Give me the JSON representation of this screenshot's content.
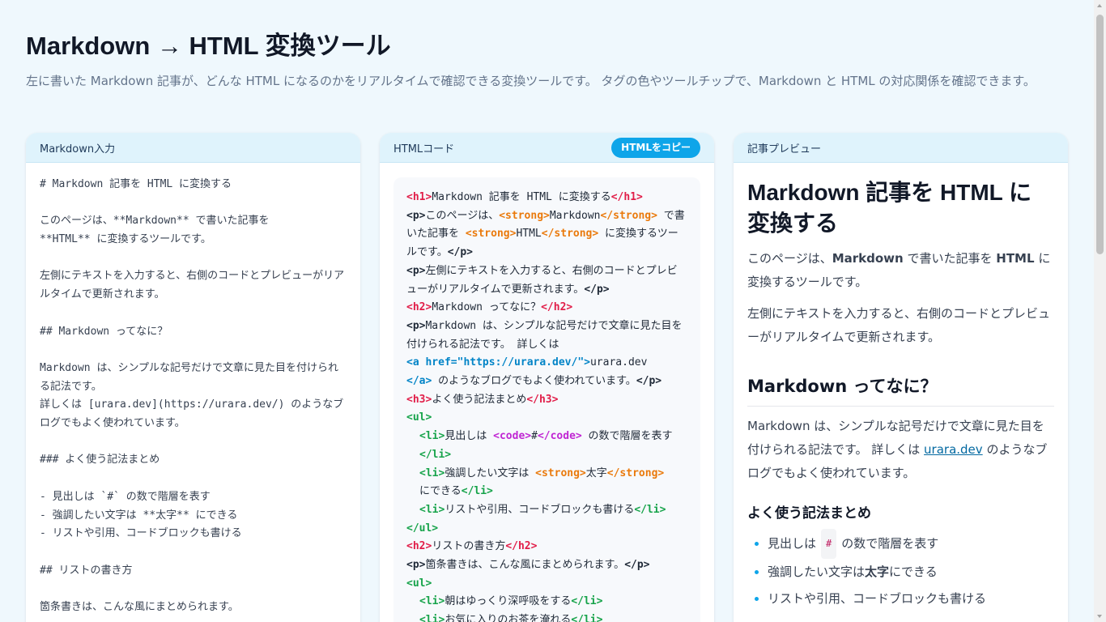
{
  "header": {
    "title": "Markdown → HTML 変換ツール",
    "description": "左に書いた Markdown 記事が、どんな HTML になるのかをリアルタイムで確認できる変換ツールです。 タグの色やツールチップで、Markdown と HTML の対応関係を確認できます。"
  },
  "panels": {
    "markdown_label": "Markdown入力",
    "html_label": "HTMLコード",
    "copy_button": "HTMLをコピー",
    "preview_label": "記事プレビュー"
  },
  "markdown_lines": [
    "# Markdown 記事を HTML に変換する",
    "",
    "このページは、**Markdown** で書いた記事を",
    "**HTML** に変換するツールです。",
    "",
    "左側にテキストを入力すると、右側のコードとプレビューがリアルタイムで更新されます。",
    "",
    "## Markdown ってなに？",
    "",
    "Markdown は、シンプルな記号だけで文章に見た目を付けられる記法です。",
    "詳しくは [urara.dev](https://urara.dev/) のようなブログでもよく使われています。",
    "",
    "### よく使う記法まとめ",
    "",
    "- 見出しは `#` の数で階層を表す",
    "- 強調したい文字は **太字** にできる",
    "- リストや引用、コードブロックも書ける",
    "",
    "## リストの書き方",
    "",
    "箇条書きは、こんな風にまとめられます。"
  ],
  "html_code": {
    "h1_text": "Markdown 記事を HTML に変換する",
    "p1_pre": "このページは、",
    "p1_strong1": "Markdown",
    "p1_mid": " で書いた記事を ",
    "p1_strong2": "HTML",
    "p1_post": " に変換するツールです。",
    "p2_text": "左側にテキストを入力すると、右側のコードとプレビューがリアルタイムで更新されます。",
    "h2a_text": "Markdown ってなに？",
    "p3_text": "Markdown は、シンプルな記号だけで文章に見た目を付けられる記法です。 詳しくは",
    "a_open": "<a href=\"https://urara.dev/\">",
    "a_text": "urara.dev",
    "a_close": "</a>",
    "p3_post": " のようなブログでもよく使われています。",
    "h3_text": "よく使う記法まとめ",
    "li1_pre": "見出しは ",
    "li1_code": "#",
    "li1_post": " の数で階層を表す",
    "li2_pre": "強調したい文字は ",
    "li2_strong": "太字",
    "li2_post": "にできる",
    "li3_text": "リストや引用、コードブロックも書ける",
    "h2b_text": "リストの書き方",
    "p4_text": "箇条書きは、こんな風にまとめられます。",
    "li4_text": "朝はゆっくり深呼吸をする",
    "li5_text": "お気に入りのお茶を淹れる"
  },
  "preview": {
    "h1": "Markdown 記事を HTML に変換する",
    "p1_pre": "このページは、",
    "p1_strong1": "Markdown",
    "p1_mid": " で書いた記事を ",
    "p1_strong2": "HTML",
    "p1_post": " に変換するツールです。",
    "p2": "左側にテキストを入力すると、右側のコードとプレビューがリアルタイムで更新されます。",
    "h2": "Markdown ってなに？",
    "p3_pre": "Markdown は、シンプルな記号だけで文章に見た目を付けられる記法です。 詳しくは ",
    "p3_link": "urara.dev",
    "p3_post": " のようなブログでもよく使われています。",
    "h3": "よく使う記法まとめ",
    "li1_pre": "見出しは",
    "li1_code": "#",
    "li1_post": "の数で階層を表す",
    "li2_pre": "強調したい文字は ",
    "li2_strong": "太字",
    "li2_post": " にできる",
    "li3": "リストや引用、コードブロックも書ける"
  },
  "colors": {
    "accent": "#0ea5e9",
    "tag_heading": "#e11d48",
    "tag_strong": "#ea7a0c",
    "tag_link": "#0284c7",
    "tag_list": "#16a34a",
    "tag_code": "#c026d3"
  }
}
